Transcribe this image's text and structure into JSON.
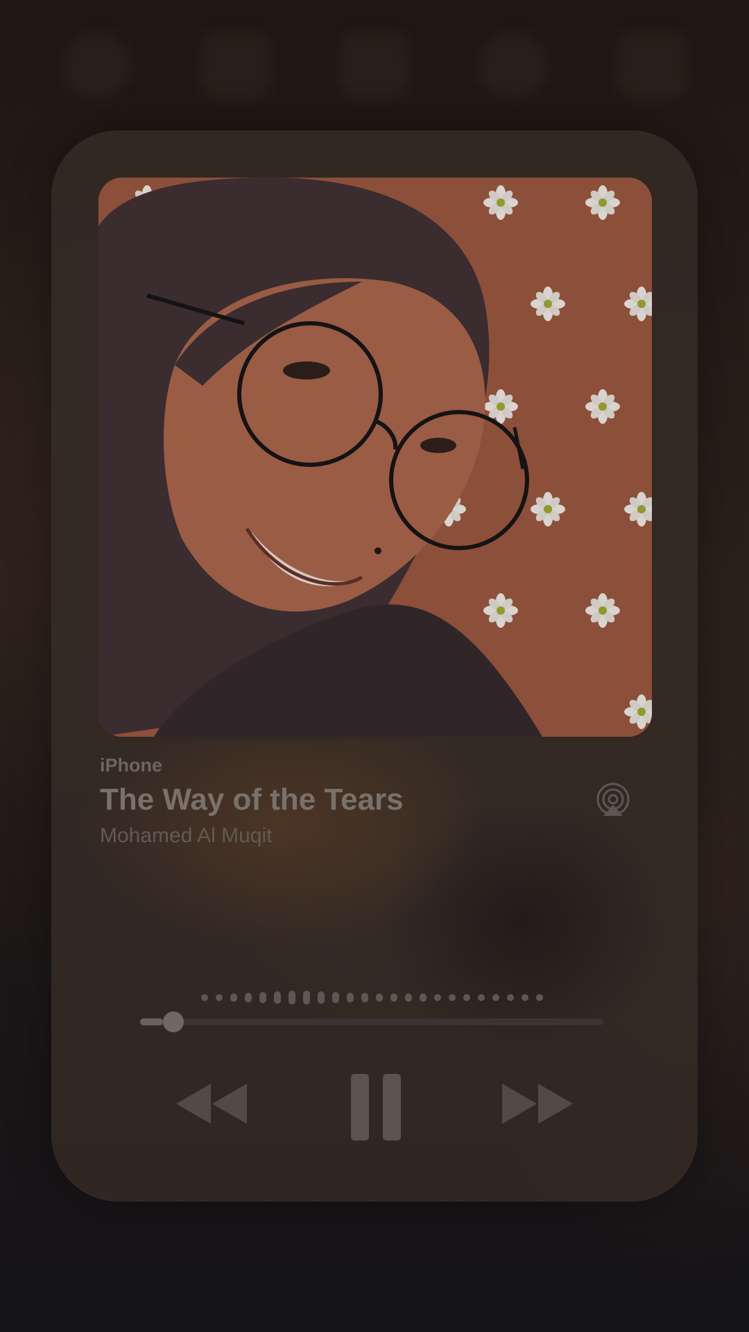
{
  "now_playing": {
    "device": "iPhone",
    "title": "The Way of the Tears",
    "artist": "Mohamed Al Muqit",
    "progress": 0.05
  },
  "controls": {
    "rewind_icon": "rewind-icon",
    "pause_icon": "pause-icon",
    "forward_icon": "fast-forward-icon",
    "source_icon": "airplay-source-icon"
  },
  "colors": {
    "card": "#362c26",
    "text_title": "#7a716b",
    "text_muted": "#625a55",
    "artwork_bg": "#8c4f3a"
  }
}
